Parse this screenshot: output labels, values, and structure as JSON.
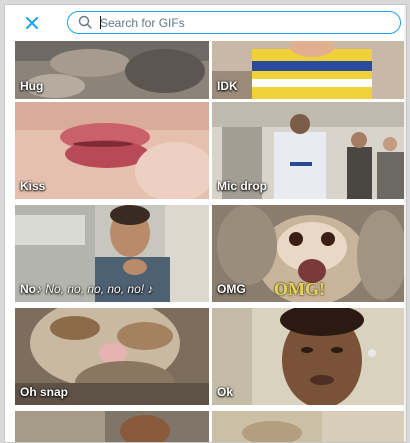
{
  "search": {
    "placeholder": "Search for GIFs",
    "value": ""
  },
  "colors": {
    "accent": "#1da1f2",
    "label_text": "#ffffff"
  },
  "icons": {
    "close": "close-icon",
    "search": "search-icon"
  },
  "gifs": [
    {
      "label": "Hug",
      "caption": ""
    },
    {
      "label": "IDK",
      "caption": ""
    },
    {
      "label": "Kiss",
      "caption": ""
    },
    {
      "label": "Mic drop",
      "caption": ""
    },
    {
      "label": "No",
      "caption": "♪ No, no, no, no, no! ♪"
    },
    {
      "label": "OMG",
      "caption": "OMG!"
    },
    {
      "label": "Oh snap",
      "caption": ""
    },
    {
      "label": "Ok",
      "caption": ""
    },
    {
      "label": "",
      "caption": ""
    },
    {
      "label": "",
      "caption": ""
    }
  ]
}
